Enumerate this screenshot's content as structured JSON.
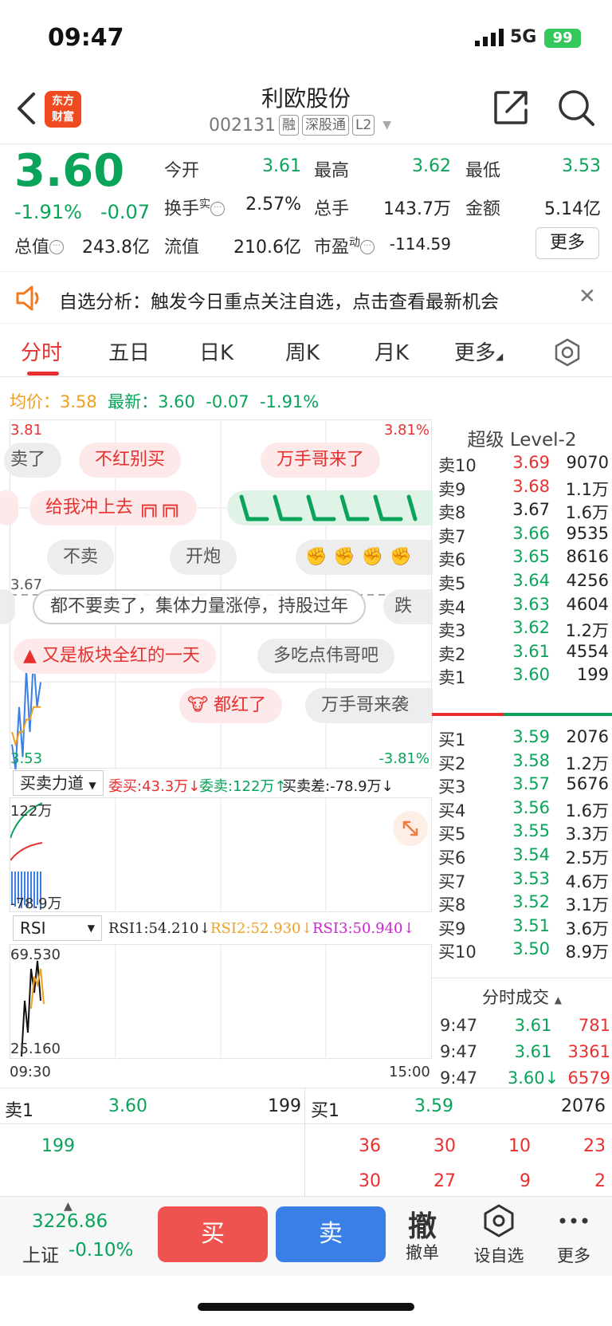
{
  "status_bar": {
    "time": "09:47",
    "network": "5G",
    "battery": "99"
  },
  "header": {
    "title": "利欧股份",
    "code": "002131",
    "tags": [
      "融",
      "深股通",
      "L2"
    ],
    "logo_text": [
      "东方",
      "财富"
    ]
  },
  "quote": {
    "price": "3.60",
    "change_pct": "-1.91%",
    "change": "-0.07",
    "open_label": "今开",
    "open": "3.61",
    "high_label": "最高",
    "high": "3.62",
    "low_label": "最低",
    "low": "3.53",
    "turnover_label": "换手",
    "turnover_sup": "实",
    "turnover": "2.57%",
    "volume_label": "总手",
    "volume": "143.7万",
    "amount_label": "金额",
    "amount": "5.14亿",
    "total_cap_label": "总值",
    "total_cap": "243.8亿",
    "float_cap_label": "流值",
    "float_cap": "210.6亿",
    "pe_label": "市盈",
    "pe_sup": "动",
    "pe": "-114.59",
    "more_label": "更多"
  },
  "alert": {
    "text": "自选分析：触发今日重点关注自选，点击查看最新机会"
  },
  "tabs": [
    "分时",
    "五日",
    "日K",
    "周K",
    "月K",
    "更多"
  ],
  "avg_line": {
    "avg_label": "均价：",
    "avg": "3.58",
    "last_label": "最新：",
    "last": "3.60",
    "chg": "-0.07",
    "pct": "-1.91%"
  },
  "chart": {
    "y_top": "3.81",
    "y_top_pct": "3.81%",
    "y_bottom": "3.53",
    "y_bottom_pct": "-3.81%",
    "ref_price": "3.67",
    "time_start": "09:30",
    "time_end": "15:00",
    "bubbles": [
      "卖了",
      "不红别买",
      "万手哥来了",
      "给我冲上去",
      "不卖",
      "开炮",
      "都不要卖了，集体力量涨停，持股过年",
      "跌",
      "又是板块全红的一天",
      "多吃点伟哥吧",
      "都红了",
      "万手哥来袭"
    ]
  },
  "chart_data": {
    "type": "line",
    "series": [
      {
        "name": "最新",
        "values": [
          3.55,
          3.53,
          3.58,
          3.54,
          3.61,
          3.56,
          3.62,
          3.58,
          3.6
        ]
      },
      {
        "name": "均价",
        "values": [
          3.56,
          3.55,
          3.56,
          3.56,
          3.57,
          3.57,
          3.58,
          3.58,
          3.58
        ]
      }
    ],
    "ylim": [
      3.53,
      3.81
    ]
  },
  "flow": {
    "selector": "买卖力道",
    "buy_label": "委买:43.3万",
    "sell_label": "委卖:122万",
    "diff_label": "买卖差:-78.9万",
    "y_top": "122万",
    "y_bottom": "-78.9万"
  },
  "rsi": {
    "selector": "RSI",
    "rsi1": "RSI1:54.210",
    "rsi2": "RSI2:52.930",
    "rsi3": "RSI3:50.940",
    "y_top": "69.530",
    "y_bottom": "25.160"
  },
  "level2": {
    "title": "超级 Level-2",
    "asks": [
      {
        "n": "卖10",
        "p": "3.69",
        "v": "9070",
        "c": "red"
      },
      {
        "n": "卖9",
        "p": "3.68",
        "v": "1.1万",
        "c": "red"
      },
      {
        "n": "卖8",
        "p": "3.67",
        "v": "1.6万",
        "c": "black"
      },
      {
        "n": "卖7",
        "p": "3.66",
        "v": "9535",
        "c": "green"
      },
      {
        "n": "卖6",
        "p": "3.65",
        "v": "8616",
        "c": "green"
      },
      {
        "n": "卖5",
        "p": "3.64",
        "v": "4256",
        "c": "green"
      },
      {
        "n": "卖4",
        "p": "3.63",
        "v": "4604",
        "c": "green"
      },
      {
        "n": "卖3",
        "p": "3.62",
        "v": "1.2万",
        "c": "green"
      },
      {
        "n": "卖2",
        "p": "3.61",
        "v": "4554",
        "c": "green"
      },
      {
        "n": "卖1",
        "p": "3.60",
        "v": "199",
        "c": "green"
      }
    ],
    "bids": [
      {
        "n": "买1",
        "p": "3.59",
        "v": "2076",
        "c": "green"
      },
      {
        "n": "买2",
        "p": "3.58",
        "v": "1.2万",
        "c": "green"
      },
      {
        "n": "买3",
        "p": "3.57",
        "v": "5676",
        "c": "green"
      },
      {
        "n": "买4",
        "p": "3.56",
        "v": "1.6万",
        "c": "green"
      },
      {
        "n": "买5",
        "p": "3.55",
        "v": "3.3万",
        "c": "green"
      },
      {
        "n": "买6",
        "p": "3.54",
        "v": "2.5万",
        "c": "green"
      },
      {
        "n": "买7",
        "p": "3.53",
        "v": "4.6万",
        "c": "green"
      },
      {
        "n": "买8",
        "p": "3.52",
        "v": "3.1万",
        "c": "green"
      },
      {
        "n": "买9",
        "p": "3.51",
        "v": "3.6万",
        "c": "green"
      },
      {
        "n": "买10",
        "p": "3.50",
        "v": "8.9万",
        "c": "green"
      }
    ],
    "ticks_title": "分时成交",
    "ticks": [
      {
        "t": "9:47",
        "p": "3.61",
        "v": "781"
      },
      {
        "t": "9:47",
        "p": "3.61",
        "v": "3361"
      },
      {
        "t": "9:47",
        "p": "3.60↓",
        "v": "6579"
      }
    ]
  },
  "bottom_quote": {
    "sell_label": "卖1",
    "sell_price": "3.60",
    "sell_vol": "199",
    "buy_label": "买1",
    "buy_price": "3.59",
    "buy_vol": "2076",
    "sell_queue": [
      "199"
    ],
    "buy_queue_row1": [
      "36",
      "30",
      "10",
      "23"
    ],
    "buy_queue_row2": [
      "30",
      "27",
      "9",
      "2"
    ]
  },
  "actions": {
    "index_value": "3226.86",
    "index_name": "上证",
    "index_change": "-0.10%",
    "buy": "买",
    "sell": "卖",
    "cancel_icon_text": "撤",
    "cancel": "撤单",
    "watch": "设自选",
    "more": "更多"
  },
  "colors": {
    "red": "#e8302f",
    "green": "#0aa35a",
    "blue": "#3a7fe6"
  }
}
